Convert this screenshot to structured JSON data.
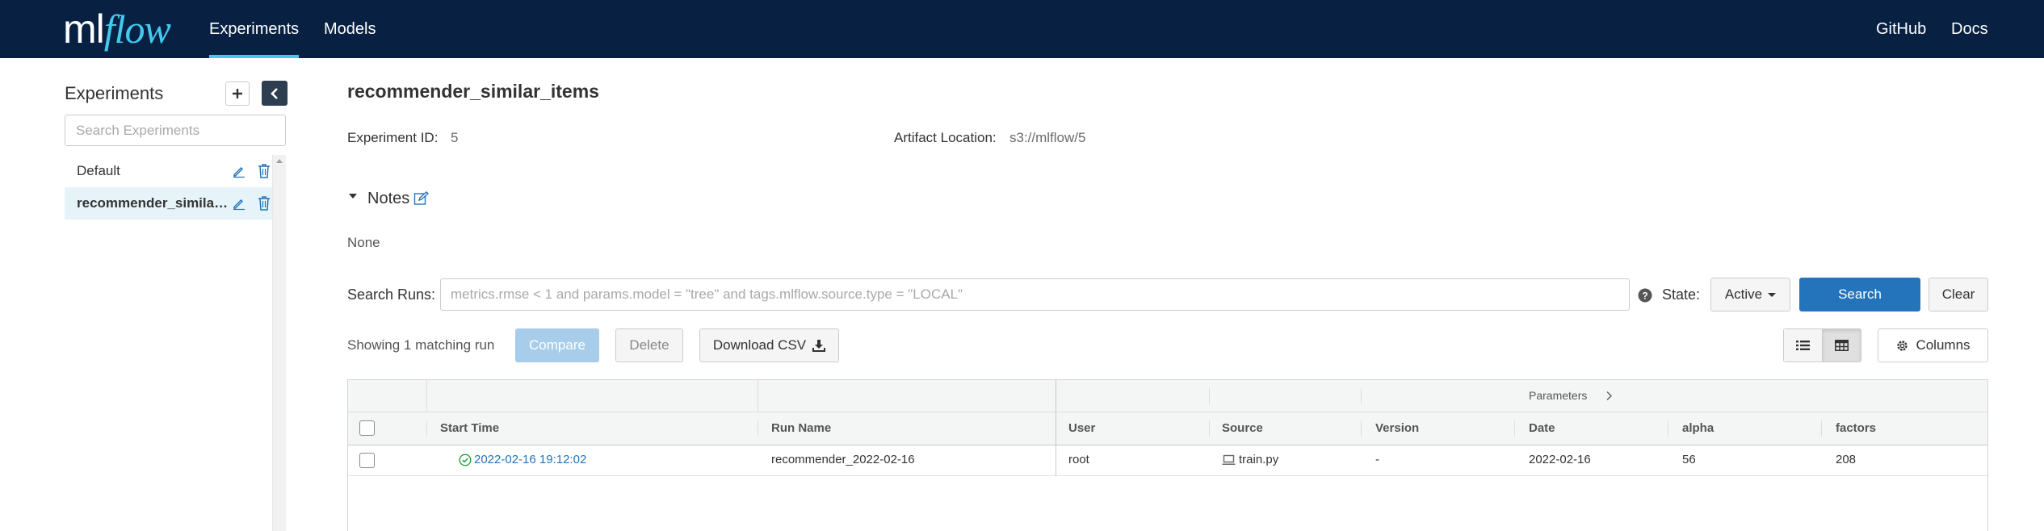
{
  "topbar": {
    "logo_ml": "ml",
    "logo_flow": "flow",
    "nav": [
      {
        "label": "Experiments",
        "active": true
      },
      {
        "label": "Models",
        "active": false
      }
    ],
    "right_links": [
      "GitHub",
      "Docs"
    ],
    "colors": {
      "background": "#082142",
      "accent": "#43c9ed"
    }
  },
  "sidebar": {
    "title": "Experiments",
    "add_icon": "plus-icon",
    "collapse_icon": "chevron-left-icon",
    "search_placeholder": "Search Experiments",
    "items": [
      {
        "name": "Default",
        "active": false
      },
      {
        "name": "recommender_similar_items",
        "active": true
      }
    ]
  },
  "experiment": {
    "title": "recommender_similar_items",
    "id_label": "Experiment ID:",
    "id_value": "5",
    "artifact_label": "Artifact Location:",
    "artifact_value": "s3://mlflow/5"
  },
  "notes": {
    "title": "Notes",
    "body": "None"
  },
  "search": {
    "label": "Search Runs:",
    "placeholder": "metrics.rmse < 1 and params.model = \"tree\" and tags.mlflow.source.type = \"LOCAL\"",
    "state_label": "State:",
    "state_value": "Active",
    "search_button": "Search",
    "clear_button": "Clear",
    "primary_color": "#2374bb"
  },
  "toolbar": {
    "showing": "Showing 1 matching run",
    "compare": "Compare",
    "delete": "Delete",
    "download_csv": "Download CSV",
    "columns": "Columns"
  },
  "table": {
    "group_header": "Parameters",
    "columns": [
      "Start Time",
      "Run Name",
      "User",
      "Source",
      "Version",
      "Date",
      "alpha",
      "factors"
    ],
    "rows": [
      {
        "start_time": "2022-02-16 19:12:02",
        "run_name": "recommender_2022-02-16",
        "user": "root",
        "source": "train.py",
        "version": "-",
        "date": "2022-02-16",
        "alpha": "56",
        "factors": "208",
        "status": "finished"
      }
    ]
  }
}
